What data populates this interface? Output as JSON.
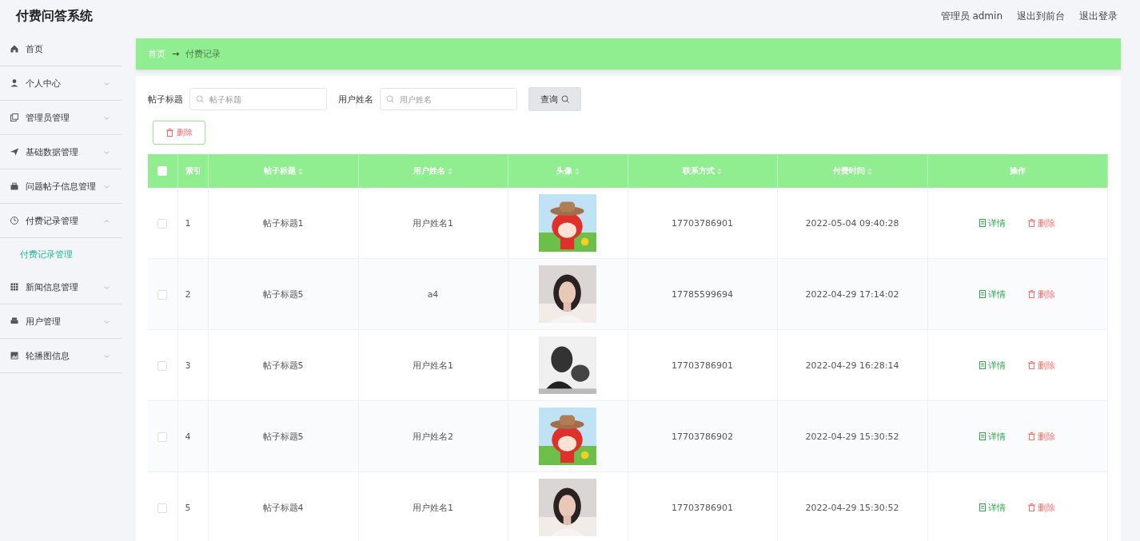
{
  "app_title": "付费问答系统",
  "header_links": [
    {
      "label": "管理员 admin"
    },
    {
      "label": "退出到前台"
    },
    {
      "label": "退出登录"
    }
  ],
  "sidebar": {
    "items": [
      {
        "label": "首页"
      },
      {
        "label": "个人中心",
        "expanded": false
      },
      {
        "label": "管理员管理",
        "expanded": false
      },
      {
        "label": "基础数据管理",
        "expanded": false
      },
      {
        "label": "问题帖子信息管理",
        "expanded": false
      },
      {
        "label": "付费记录管理",
        "expanded": true,
        "children": [
          {
            "label": "付费记录管理",
            "selected": true
          }
        ]
      },
      {
        "label": "新闻信息管理",
        "expanded": false
      },
      {
        "label": "用户管理",
        "expanded": false
      },
      {
        "label": "轮播图信息",
        "expanded": false
      }
    ]
  },
  "breadcrumb": {
    "home": "首页",
    "separator": "→",
    "current": "付费记录"
  },
  "filters": [
    {
      "label": "帖子标题",
      "placeholder": "帖子标题"
    },
    {
      "label": "用户姓名",
      "placeholder": "用户姓名"
    }
  ],
  "search_button": "查询",
  "delete_button": "删除",
  "table": {
    "select_all": {
      "checked": false
    },
    "columns": [
      {
        "label": "索引",
        "sortable": false
      },
      {
        "label": "帖子标题",
        "sortable": true
      },
      {
        "label": "用户姓名",
        "sortable": true
      },
      {
        "label": "头像",
        "sortable": true
      },
      {
        "label": "联系方式",
        "sortable": true
      },
      {
        "label": "付费时间",
        "sortable": true
      },
      {
        "label": "操作",
        "sortable": false
      }
    ],
    "rows": [
      {
        "checked": false,
        "index": "1",
        "title": "帖子标题1",
        "user": "用户姓名1",
        "avatar": {
          "kind": "picture"
        },
        "contact": "17703786901",
        "time": "2022-05-04 09:40:28",
        "actions": [
          "详情",
          "删除"
        ]
      },
      {
        "checked": false,
        "index": "2",
        "title": "帖子标题5",
        "user": "a4",
        "avatar": {
          "kind": "picture"
        },
        "contact": "17785599694",
        "time": "2022-04-29 17:14:02",
        "actions": [
          "详情",
          "删除"
        ]
      },
      {
        "checked": false,
        "index": "3",
        "title": "帖子标题5",
        "user": "用户姓名1",
        "avatar": {
          "kind": "picture"
        },
        "contact": "17703786901",
        "time": "2022-04-29 16:28:14",
        "actions": [
          "详情",
          "删除"
        ]
      },
      {
        "checked": false,
        "index": "4",
        "title": "帖子标题5",
        "user": "用户姓名2",
        "avatar": {
          "kind": "picture"
        },
        "contact": "17703786902",
        "time": "2022-04-29 15:30:52",
        "actions": [
          "详情",
          "删除"
        ]
      },
      {
        "checked": false,
        "index": "5",
        "title": "帖子标题4",
        "user": "用户姓名1",
        "avatar": {
          "kind": "picture"
        },
        "contact": "17703786901",
        "time": "2022-04-29 15:30:52",
        "actions": [
          "详情",
          "删除"
        ]
      }
    ]
  }
}
